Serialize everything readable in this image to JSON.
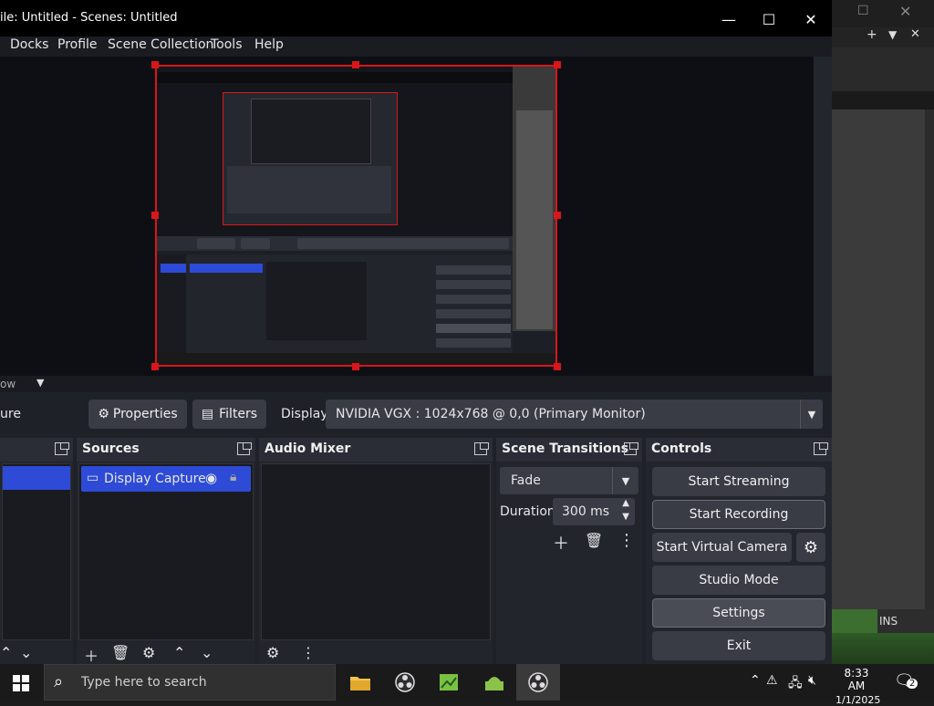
{
  "window": {
    "title": "File: Untitled - Scenes: Untitled",
    "title_visible": "ile: Untitled - Scenes: Untitled",
    "controls": [
      "minimize",
      "maximize",
      "close"
    ]
  },
  "menu": [
    "Docks",
    "Profile",
    "Scene Collection",
    "Tools",
    "Help"
  ],
  "preview_strip": {
    "label": "ow"
  },
  "source_toolbar": {
    "left_label": "ure",
    "properties": "Properties",
    "filters": "Filters",
    "display_label": "Display",
    "display_value": "NVIDIA VGX : 1024x768 @ 0,0 (Primary Monitor)"
  },
  "docks": {
    "sources": {
      "title": "Sources",
      "items": [
        "Display Capture"
      ]
    },
    "audio_mixer": {
      "title": "Audio Mixer"
    },
    "scene_transitions": {
      "title": "Scene Transitions",
      "transition": "Fade",
      "duration_label": "Duration",
      "duration_value": "300 ms"
    },
    "controls": {
      "title": "Controls",
      "start_streaming": "Start Streaming",
      "start_recording": "Start Recording",
      "start_virtual_camera": "Start Virtual Camera",
      "studio_mode": "Studio Mode",
      "settings": "Settings",
      "exit": "Exit"
    }
  },
  "background_window": {
    "status": "INS"
  },
  "taskbar": {
    "search_placeholder": "Type here to search",
    "time": "8:33 AM",
    "date": "1/1/2025",
    "notifications": "2"
  },
  "colors": {
    "accent": "#2d4bd6",
    "selection_red": "#d8161b"
  }
}
